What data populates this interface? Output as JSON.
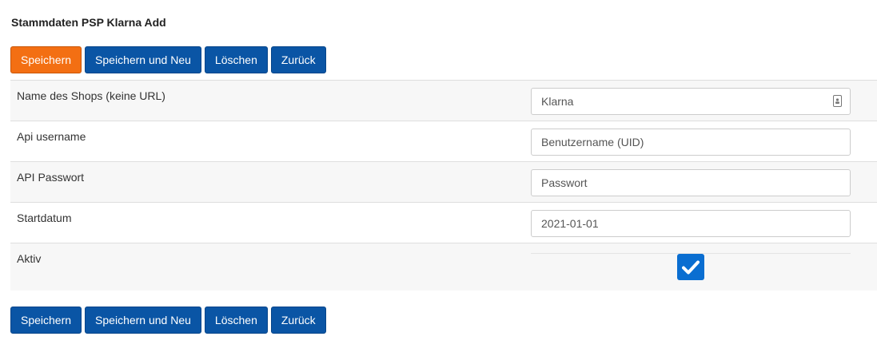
{
  "page": {
    "title": "Stammdaten PSP Klarna Add"
  },
  "toolbar": {
    "save_label": "Speichern",
    "save_new_label": "Speichern und Neu",
    "delete_label": "Löschen",
    "back_label": "Zurück"
  },
  "form": {
    "shop_name": {
      "label": "Name des Shops (keine URL)",
      "value": "Klarna",
      "icon": "contact-card-icon"
    },
    "api_username": {
      "label": "Api username",
      "placeholder": "Benutzername (UID)"
    },
    "api_password": {
      "label": "API Passwort",
      "placeholder": "Passwort"
    },
    "start_date": {
      "label": "Startdatum",
      "value": "2021-01-01"
    },
    "active": {
      "label": "Aktiv",
      "checked": true
    }
  },
  "colors": {
    "primary_button": "#f36f13",
    "button": "#0a55a5",
    "checkbox": "#0a6ed1"
  }
}
